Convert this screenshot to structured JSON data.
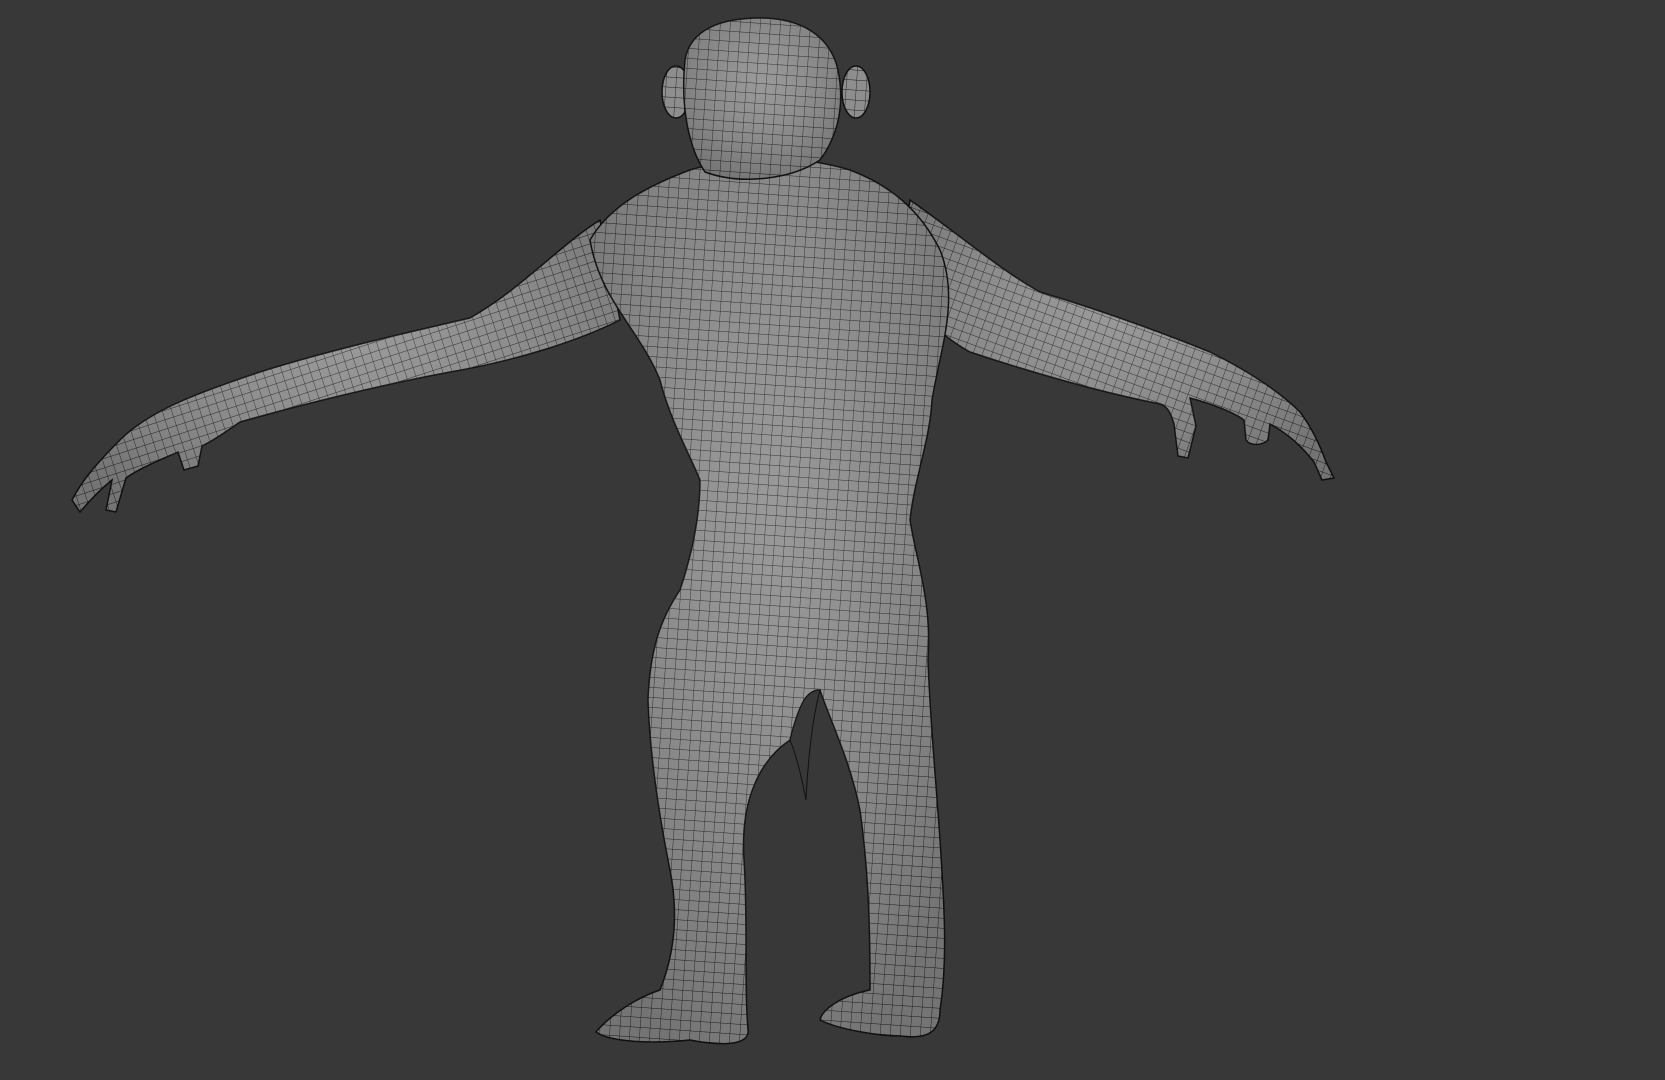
{
  "viewport": {
    "background_color": "#383838",
    "object": {
      "kind": "polygon-mesh-wireframe-on-shaded",
      "subject": "chimpanzee-figure-back-view",
      "surface_color": "#8e8e8e",
      "wire_color": "#1f1f1f"
    }
  }
}
